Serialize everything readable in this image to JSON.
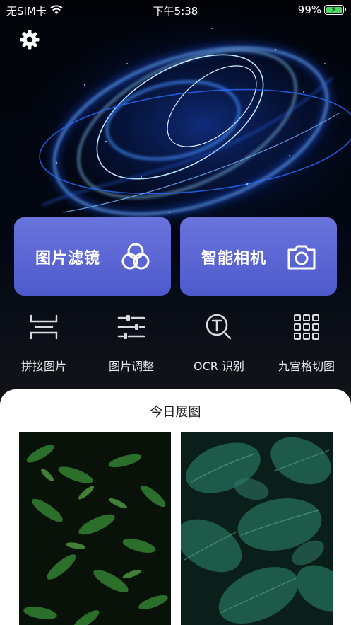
{
  "status": {
    "carrier": "无SIM卡",
    "time": "下午5:38",
    "battery": "99%",
    "battery_level": 0.99
  },
  "header": {
    "settings_icon": "gear-icon"
  },
  "main_actions": [
    {
      "label": "图片滤镜",
      "icon": "filter-circles-icon"
    },
    {
      "label": "智能相机",
      "icon": "camera-icon"
    }
  ],
  "tools": [
    {
      "label": "拼接图片",
      "icon": "stitch-icon"
    },
    {
      "label": "图片调整",
      "icon": "sliders-icon"
    },
    {
      "label": "OCR 识别",
      "icon": "ocr-search-icon"
    },
    {
      "label": "九宫格切图",
      "icon": "grid-icon"
    }
  ],
  "today": {
    "title": "今日展图",
    "photos": [
      {
        "subject": "fern-leaves-photo"
      },
      {
        "subject": "tropical-leaves-photo"
      }
    ]
  },
  "colors": {
    "accent_gradient_top": "#6a74dc",
    "accent_gradient_bottom": "#4e5acc",
    "battery_green": "#4cd964",
    "swirl_blue": "#3a8cff"
  }
}
